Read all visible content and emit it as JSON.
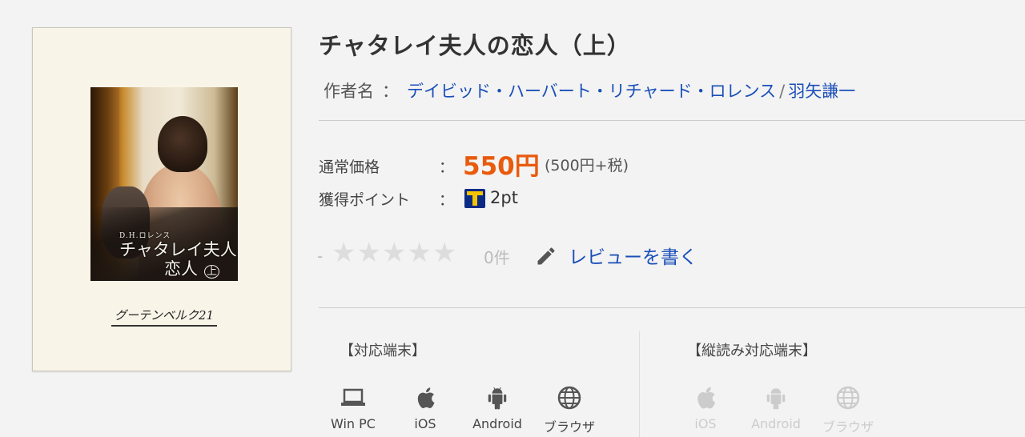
{
  "book": {
    "cover": {
      "author_text": "D.H.ロレンス",
      "title_line1": "チャタレイ夫人の",
      "title_line2": "恋人",
      "volume": "上",
      "publisher": "グーテンベルク21"
    },
    "title": "チャタレイ夫人の恋人（上）",
    "author_label": "作者名",
    "author_colon": "：",
    "authors": [
      "デイビッド・ハーバート・リチャード・ロレンス",
      "羽矢謙一"
    ],
    "author_separator": "/"
  },
  "price": {
    "label": "通常価格",
    "colon": "：",
    "value": "550円",
    "tax_note": "(500円+税)"
  },
  "points": {
    "label": "獲得ポイント",
    "colon": "：",
    "value": "2pt",
    "icon": "t-point-icon"
  },
  "review": {
    "rating_dash": "-",
    "stars": "★★★★★",
    "rating_value": 0,
    "count": "0件",
    "write_link": "レビューを書く"
  },
  "devices": {
    "supported_heading": "【対応端末】",
    "supported": [
      {
        "label": "Win PC",
        "icon": "laptop-icon",
        "enabled": true
      },
      {
        "label": "iOS",
        "icon": "apple-icon",
        "enabled": true
      },
      {
        "label": "Android",
        "icon": "android-icon",
        "enabled": true
      },
      {
        "label": "ブラウザ",
        "icon": "globe-icon",
        "enabled": true
      }
    ],
    "vertical_heading": "【縦読み対応端末】",
    "vertical": [
      {
        "label": "iOS",
        "icon": "apple-icon",
        "enabled": false
      },
      {
        "label": "Android",
        "icon": "android-icon",
        "enabled": false
      },
      {
        "label": "ブラウザ",
        "icon": "globe-icon",
        "enabled": false
      }
    ]
  },
  "colors": {
    "price": "#e85a0c",
    "link": "#1a4fb8",
    "star_empty": "#dddddd",
    "disabled": "#cccccc"
  }
}
